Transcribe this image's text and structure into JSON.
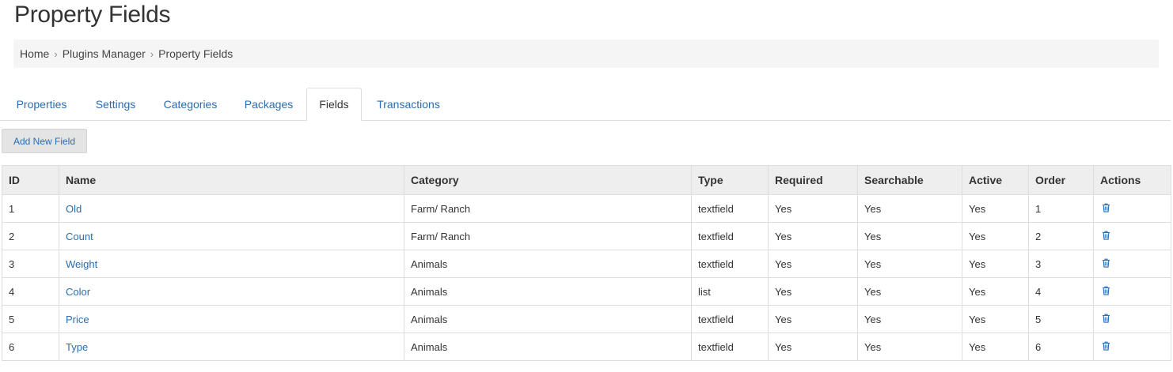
{
  "page": {
    "title": "Property Fields"
  },
  "breadcrumb": [
    {
      "label": "Home"
    },
    {
      "label": "Plugins Manager"
    },
    {
      "label": "Property Fields"
    }
  ],
  "tabs": [
    {
      "label": "Properties",
      "active": false
    },
    {
      "label": "Settings",
      "active": false
    },
    {
      "label": "Categories",
      "active": false
    },
    {
      "label": "Packages",
      "active": false
    },
    {
      "label": "Fields",
      "active": true
    },
    {
      "label": "Transactions",
      "active": false
    }
  ],
  "toolbar": {
    "add_label": "Add New Field"
  },
  "table": {
    "columns": [
      "ID",
      "Name",
      "Category",
      "Type",
      "Required",
      "Searchable",
      "Active",
      "Order",
      "Actions"
    ],
    "rows": [
      {
        "id": "1",
        "name": "Old",
        "category": "Farm/ Ranch",
        "type": "textfield",
        "required": "Yes",
        "searchable": "Yes",
        "active": "Yes",
        "order": "1",
        "action_icon": "trash-icon"
      },
      {
        "id": "2",
        "name": "Count",
        "category": "Farm/ Ranch",
        "type": "textfield",
        "required": "Yes",
        "searchable": "Yes",
        "active": "Yes",
        "order": "2",
        "action_icon": "trash-icon"
      },
      {
        "id": "3",
        "name": "Weight",
        "category": "Animals",
        "type": "textfield",
        "required": "Yes",
        "searchable": "Yes",
        "active": "Yes",
        "order": "3",
        "action_icon": "trash-icon"
      },
      {
        "id": "4",
        "name": "Color",
        "category": "Animals",
        "type": "list",
        "required": "Yes",
        "searchable": "Yes",
        "active": "Yes",
        "order": "4",
        "action_icon": "trash-icon"
      },
      {
        "id": "5",
        "name": "Price",
        "category": "Animals",
        "type": "textfield",
        "required": "Yes",
        "searchable": "Yes",
        "active": "Yes",
        "order": "5",
        "action_icon": "trash-icon"
      },
      {
        "id": "6",
        "name": "Type",
        "category": "Animals",
        "type": "textfield",
        "required": "Yes",
        "searchable": "Yes",
        "active": "Yes",
        "order": "6",
        "action_icon": "trash-icon"
      }
    ]
  },
  "colors": {
    "link": "#2a6db0",
    "text": "#333333",
    "header_bg": "#eeeeee",
    "breadcrumb_bg": "#f5f5f5",
    "button_bg": "#e4e4e4",
    "border": "#dddddd"
  }
}
